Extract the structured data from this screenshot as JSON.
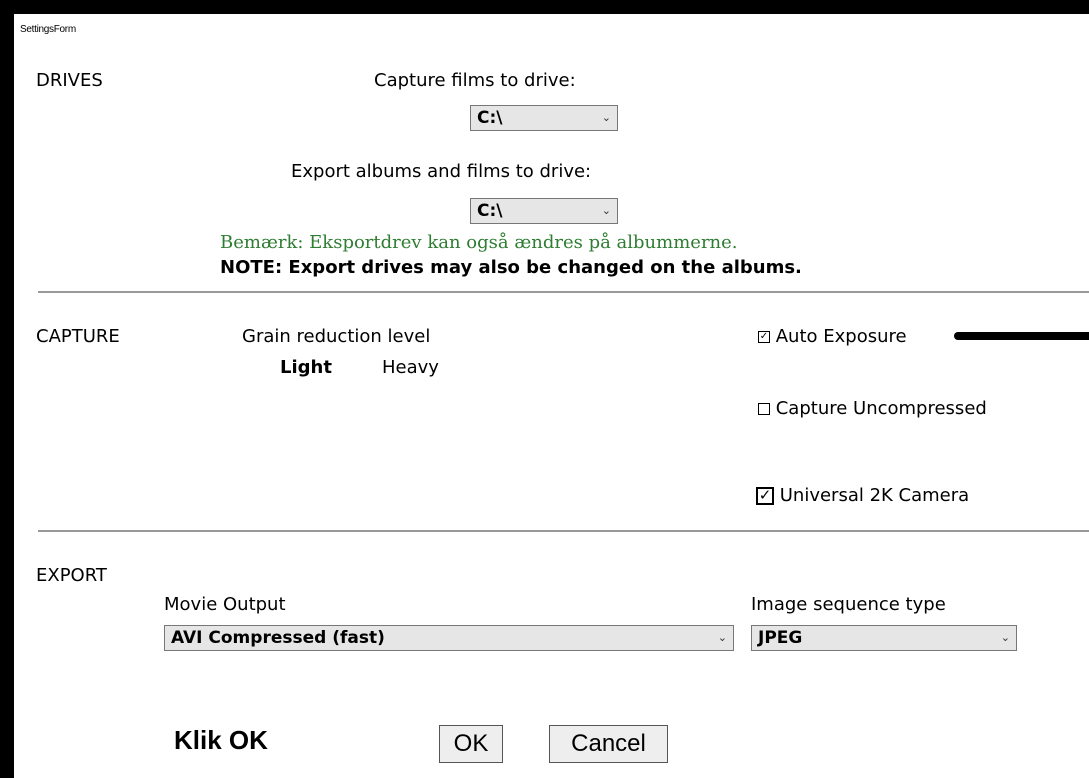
{
  "window": {
    "title": "SettingsForm"
  },
  "drives": {
    "heading": "DRIVES",
    "capture_label": "Capture films to drive:",
    "capture_value": "C:\\",
    "export_label": "Export albums and films to drive:",
    "export_value": "C:\\",
    "note_danish": "Bemærk: Eksportdrev kan også ændres på albummerne.",
    "note_english": "NOTE: Export drives may also be changed on the albums."
  },
  "capture": {
    "heading": "CAPTURE",
    "grain_label": "Grain reduction level",
    "grain_light": "Light",
    "grain_heavy": "Heavy",
    "auto_exposure": {
      "label": "Auto Exposure",
      "checked": true
    },
    "capture_uncompressed": {
      "label": "Capture Uncompressed",
      "checked": false
    },
    "universal_camera": {
      "label": "Universal 2K Camera",
      "checked": true
    }
  },
  "export": {
    "heading": "EXPORT",
    "movie_output_label": "Movie Output",
    "movie_output_value": "AVI Compressed (fast)",
    "image_seq_label": "Image sequence type",
    "image_seq_value": "JPEG"
  },
  "footer": {
    "instruction": "Klik OK",
    "ok_label": "OK",
    "cancel_label": "Cancel"
  },
  "icons": {
    "dropdown": "chevron-down-icon",
    "checkbox_checked": "checkbox-checked-icon",
    "checkbox_unchecked": "checkbox-unchecked-icon"
  }
}
